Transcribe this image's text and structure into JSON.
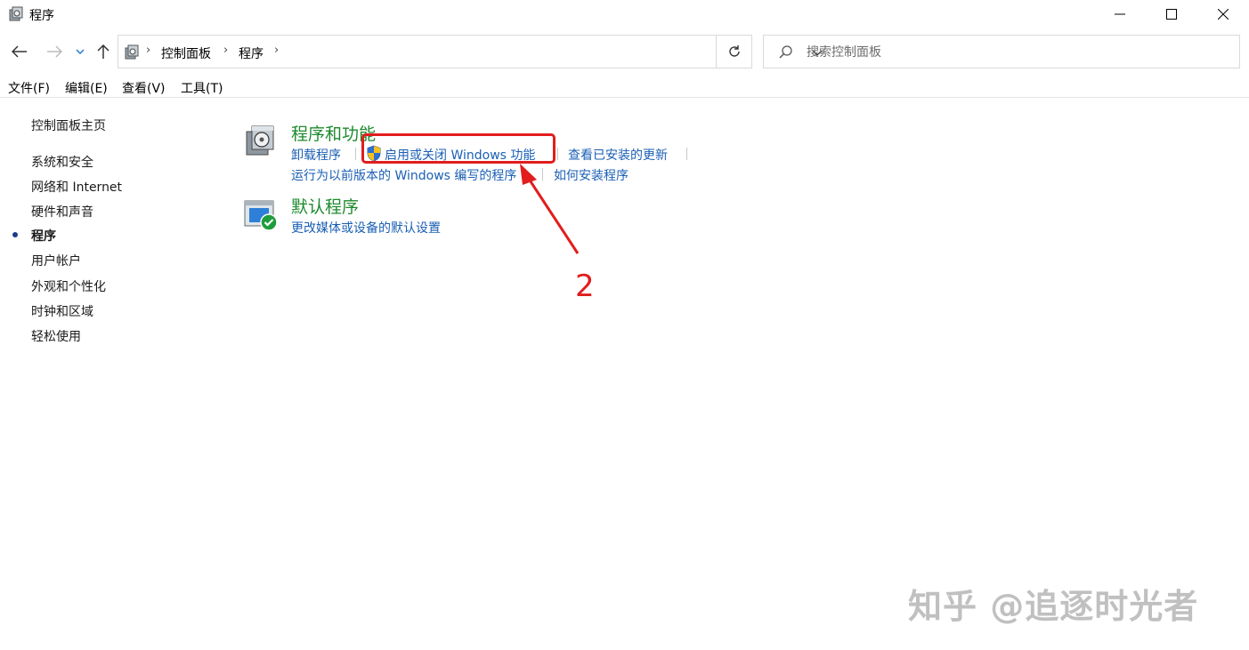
{
  "window": {
    "title": "程序",
    "icon": "programs-icon"
  },
  "nav": {
    "breadcrumb": [
      "控制面板",
      "程序"
    ]
  },
  "search": {
    "placeholder": "搜索控制面板"
  },
  "menu": [
    "文件(F)",
    "编辑(E)",
    "查看(V)",
    "工具(T)"
  ],
  "sidebar": {
    "home": "控制面板主页",
    "items": [
      {
        "label": "系统和安全",
        "active": false
      },
      {
        "label": "网络和 Internet",
        "active": false
      },
      {
        "label": "硬件和声音",
        "active": false
      },
      {
        "label": "程序",
        "active": true
      },
      {
        "label": "用户帐户",
        "active": false
      },
      {
        "label": "外观和个性化",
        "active": false
      },
      {
        "label": "时钟和区域",
        "active": false
      },
      {
        "label": "轻松使用",
        "active": false
      }
    ]
  },
  "categories": [
    {
      "title": "程序和功能",
      "icon": "programs-features-icon",
      "links": [
        "卸载程序",
        "启用或关闭 Windows 功能",
        "查看已安装的更新",
        "运行为以前版本的 Windows 编写的程序",
        "如何安装程序"
      ]
    },
    {
      "title": "默认程序",
      "icon": "default-programs-icon",
      "links": [
        "更改媒体或设备的默认设置"
      ]
    }
  ],
  "annotation": {
    "number": "2",
    "color": "#e11d1d"
  },
  "watermark": "知乎 @追逐时光者",
  "colors": {
    "category_title": "#1e8a2e",
    "link": "#1a5fb4"
  }
}
